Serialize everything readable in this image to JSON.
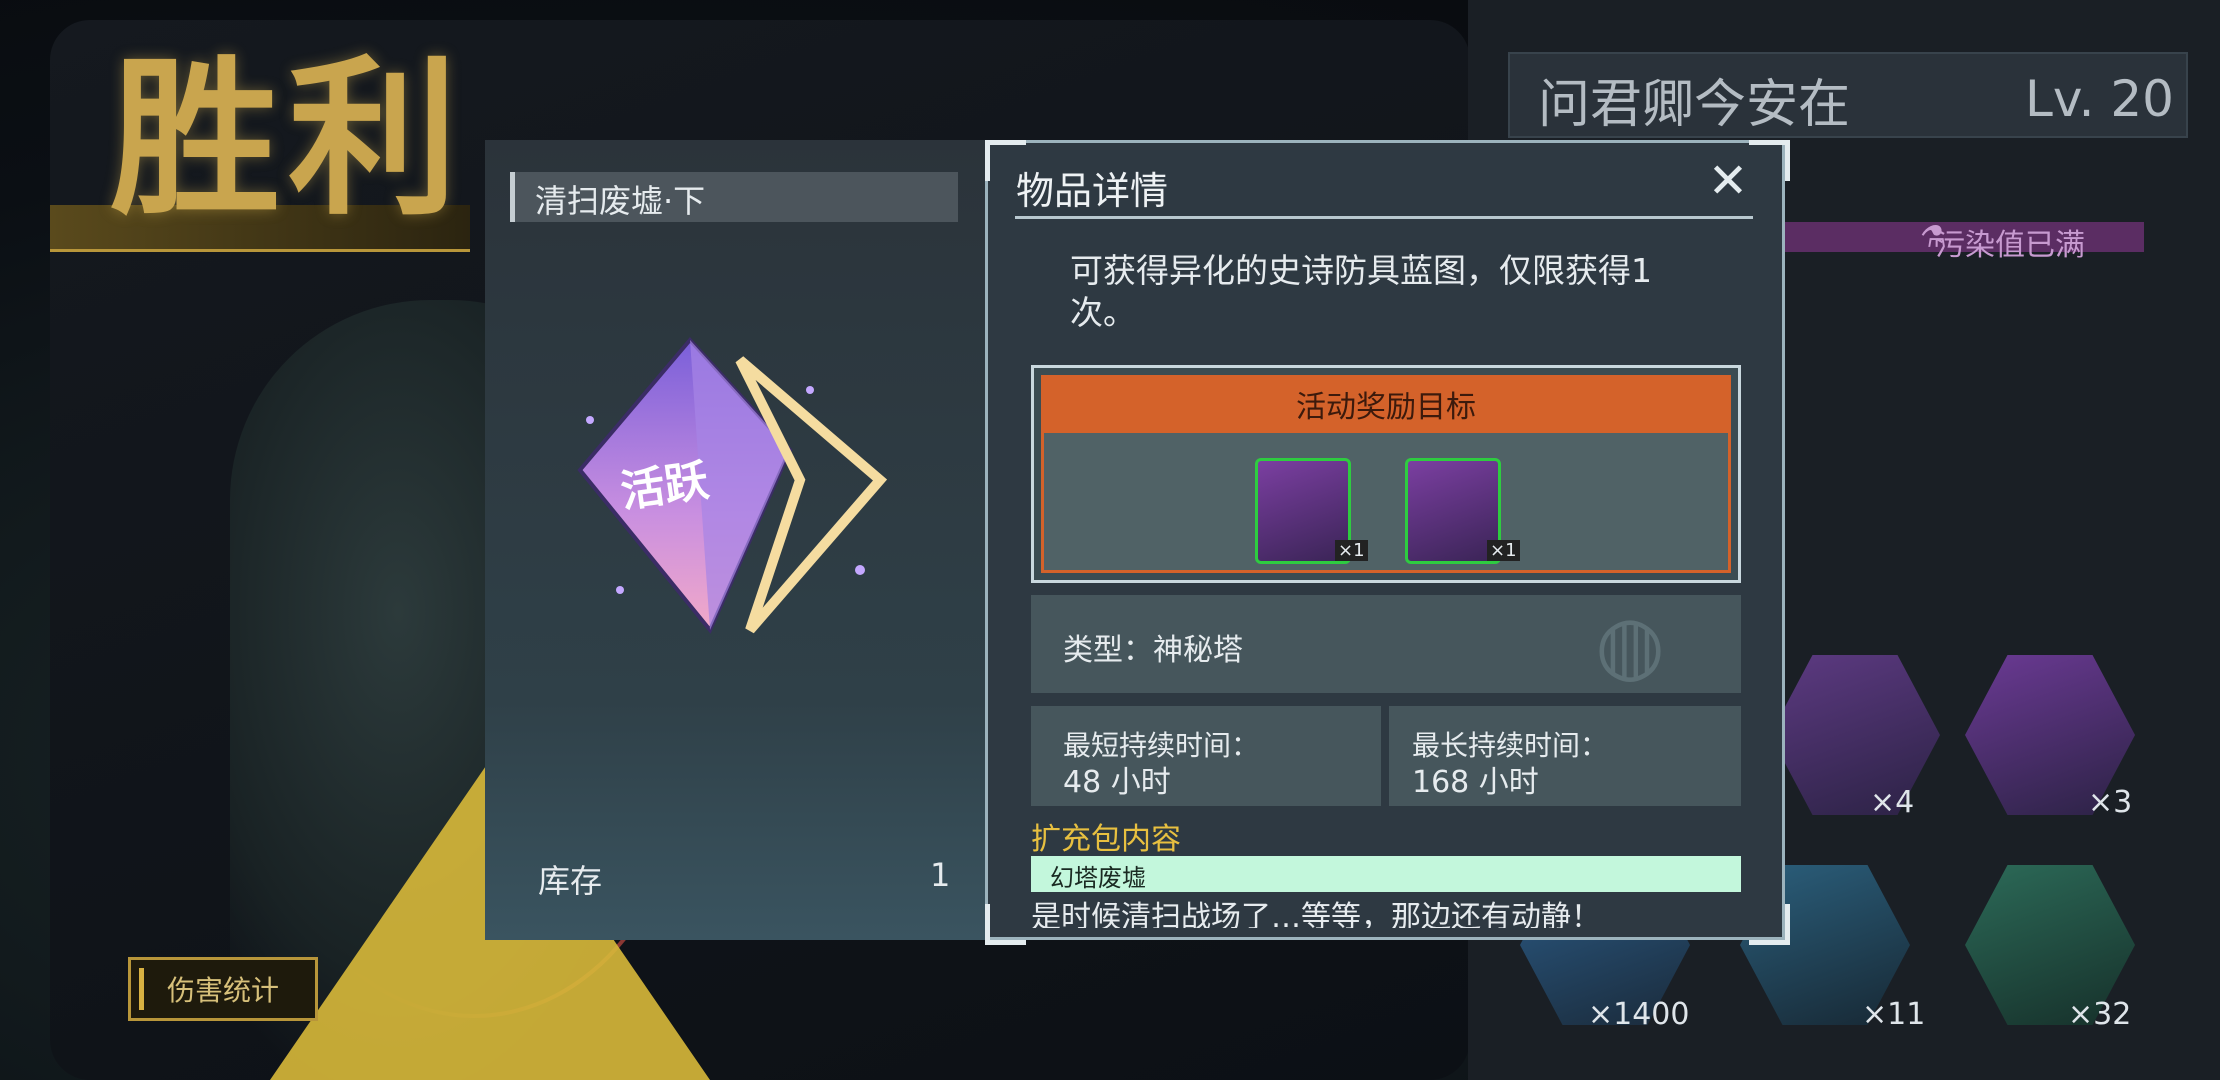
{
  "result": {
    "title": "胜利"
  },
  "buttons": {
    "damage_stats": "伤害统计"
  },
  "player": {
    "name": "问君卿今安在",
    "level": "Lv. 20",
    "status": "污染值已满"
  },
  "inventory": [
    {
      "count": "×4"
    },
    {
      "count": "×3"
    },
    {
      "count": "×1400"
    },
    {
      "count": "×11"
    },
    {
      "count": "×32"
    }
  ],
  "item": {
    "name": "清扫废墟·下",
    "crystal_text": "活跃",
    "stock_label": "库存",
    "stock_value": "1"
  },
  "details": {
    "title": "物品详情",
    "description": "可获得异化的史诗防具蓝图，仅限获得1次。",
    "reward_header": "活动奖励目标",
    "rewards": [
      {
        "count": "×1"
      },
      {
        "count": "×1"
      }
    ],
    "type_label": "类型：神秘塔",
    "min_label": "最短持续时间：",
    "min_value": "48 小时",
    "max_label": "最长持续时间：",
    "max_value": "168 小时",
    "pack_heading": "扩充包内容",
    "pack_name": "幻塔废墟",
    "flavor": "是时候清扫战场了…等等，那边还有动静！"
  },
  "colors": {
    "accent_orange": "#d4622a",
    "gold": "#c9a54e",
    "mint": "#c3f7dc",
    "reward_border": "#2ecc40"
  }
}
